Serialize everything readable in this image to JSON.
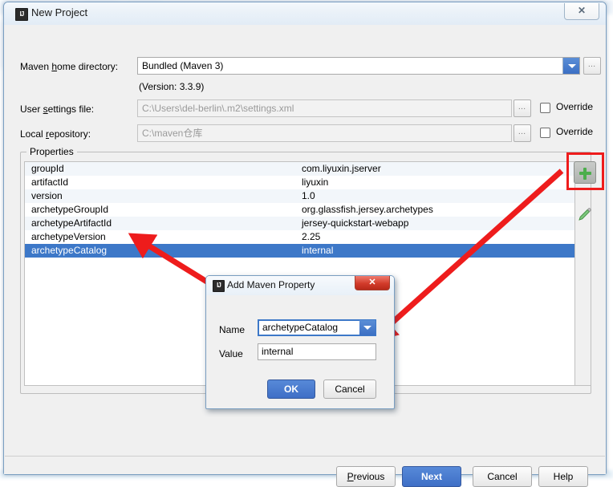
{
  "window": {
    "title": "New Project",
    "icon": "intellij-idea-icon",
    "close_label": "✕"
  },
  "form": {
    "maven_home": {
      "label_pre": "Maven ",
      "label_mnemonic": "h",
      "label_post": "ome directory:",
      "label_full": "Maven home directory:",
      "value": "Bundled (Maven 3)",
      "browse_label": "…"
    },
    "version_note": "(Version: 3.3.9)",
    "user_settings": {
      "label_pre": "User ",
      "label_mnemonic": "s",
      "label_post": "ettings file:",
      "label_full": "User settings file:",
      "value": "C:\\Users\\del-berlin\\.m2\\settings.xml",
      "browse_label": "…",
      "override_label": "Override",
      "override_checked": false
    },
    "local_repository": {
      "label_pre": "Local ",
      "label_mnemonic": "r",
      "label_post": "epository:",
      "label_full": "Local repository:",
      "value": "C:\\maven仓库",
      "browse_label": "…",
      "override_label": "Override",
      "override_checked": false
    }
  },
  "properties": {
    "legend": "Properties",
    "add_button_label": "+",
    "edit_button_label": "edit",
    "rows": [
      {
        "key": "groupId",
        "value": "com.liyuxin.jserver",
        "selected": false
      },
      {
        "key": "artifactId",
        "value": "liyuxin",
        "selected": false
      },
      {
        "key": "version",
        "value": "1.0",
        "selected": false
      },
      {
        "key": "archetypeGroupId",
        "value": "org.glassfish.jersey.archetypes",
        "selected": false
      },
      {
        "key": "archetypeArtifactId",
        "value": "jersey-quickstart-webapp",
        "selected": false
      },
      {
        "key": "archetypeVersion",
        "value": "2.25",
        "selected": false
      },
      {
        "key": "archetypeCatalog",
        "value": "internal",
        "selected": true
      }
    ]
  },
  "dialog": {
    "title": "Add Maven Property",
    "icon": "intellij-idea-icon",
    "close_label": "✕",
    "name_label": "Name",
    "name_value": "archetypeCatalog",
    "value_label": "Value",
    "value_value": "internal",
    "ok_label": "OK",
    "cancel_label": "Cancel"
  },
  "footer": {
    "previous_label": "Previous",
    "previous_mnemonic": "P",
    "next_label": "Next",
    "cancel_label": "Cancel",
    "help_label": "Help"
  },
  "annotations": {
    "arrow_color": "#ee1c1c",
    "highlight_color": "#ee1c1c",
    "arrow_1_name": "arrow-to-selected-row",
    "arrow_2_name": "arrow-to-add-button"
  },
  "colors": {
    "selection_blue": "#3d78c8",
    "accent_blue": "#3f6fc6",
    "row_stripe": "#f2f6fa",
    "window_bg": "#f0f0f0"
  }
}
